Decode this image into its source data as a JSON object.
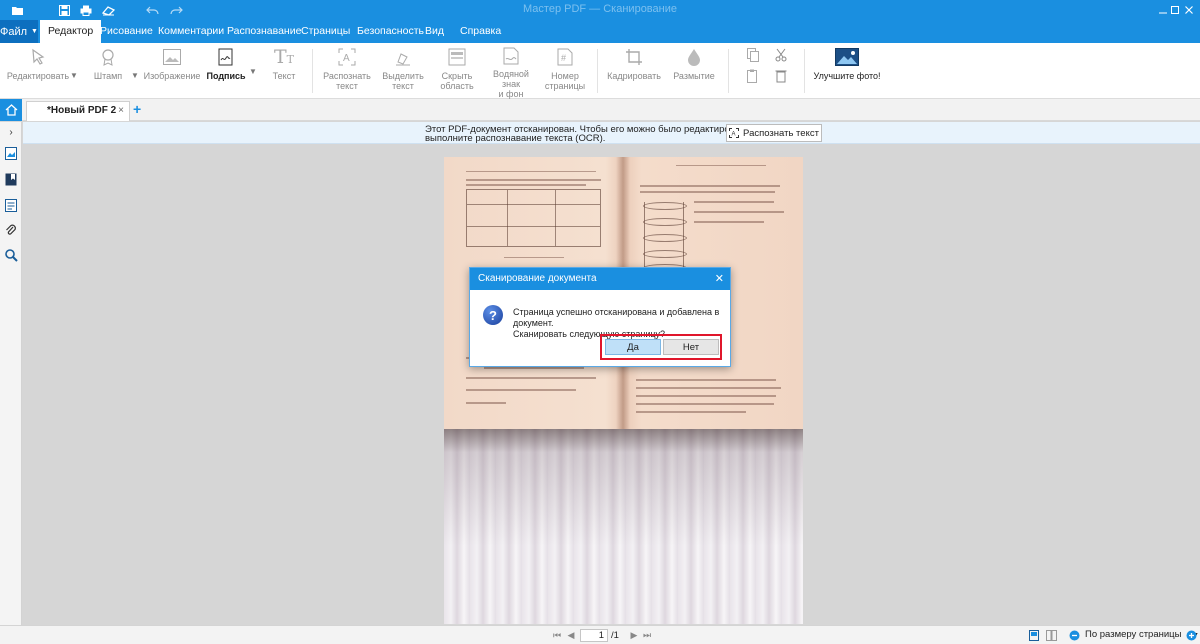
{
  "window": {
    "title": "Мастер PDF — Сканирование"
  },
  "menubar": {
    "file_label": "Файл",
    "tabs": [
      {
        "label": "Редактор",
        "active": true
      },
      {
        "label": "Рисование"
      },
      {
        "label": "Комментарии"
      },
      {
        "label": "Распознавание"
      },
      {
        "label": "Страницы"
      },
      {
        "label": "Безопасность"
      },
      {
        "label": "Вид"
      },
      {
        "label": "Справка"
      }
    ]
  },
  "ribbon": {
    "edit": "Редактировать",
    "stamp": "Штамп",
    "image": "Изображение",
    "signature": "Подпись",
    "text": "Текст",
    "recognize_line1": "Распознать",
    "recognize_line2": "текст",
    "select_line1": "Выделить",
    "select_line2": "текст",
    "hide_line1": "Скрыть",
    "hide_line2": "область",
    "watermark_line1": "Водяной знак",
    "watermark_line2": "и фон",
    "pagenum_line1": "Номер",
    "pagenum_line2": "страницы",
    "crop": "Кадрировать",
    "blur": "Размытие",
    "enhance": "Улучшите фото!"
  },
  "doc_tab": {
    "label": "*Новый PDF 2"
  },
  "ocr_banner": {
    "line1": "Этот PDF-документ отсканирован. Чтобы его можно было редактировать,",
    "line2": "выполните распознавание текста (OCR).",
    "button": "Распознать текст"
  },
  "dialog": {
    "title": "Сканирование документа",
    "line1": "Страница успешно отсканирована и добавлена в документ.",
    "line2": "Сканировать следующую страницу?",
    "yes": "Да",
    "no": "Нет"
  },
  "statusbar": {
    "current_page": "1",
    "total_pages": "/1",
    "zoom": "По размеру страницы"
  },
  "colors": {
    "accent": "#1a8fe0",
    "highlight_frame": "#e0162b"
  }
}
